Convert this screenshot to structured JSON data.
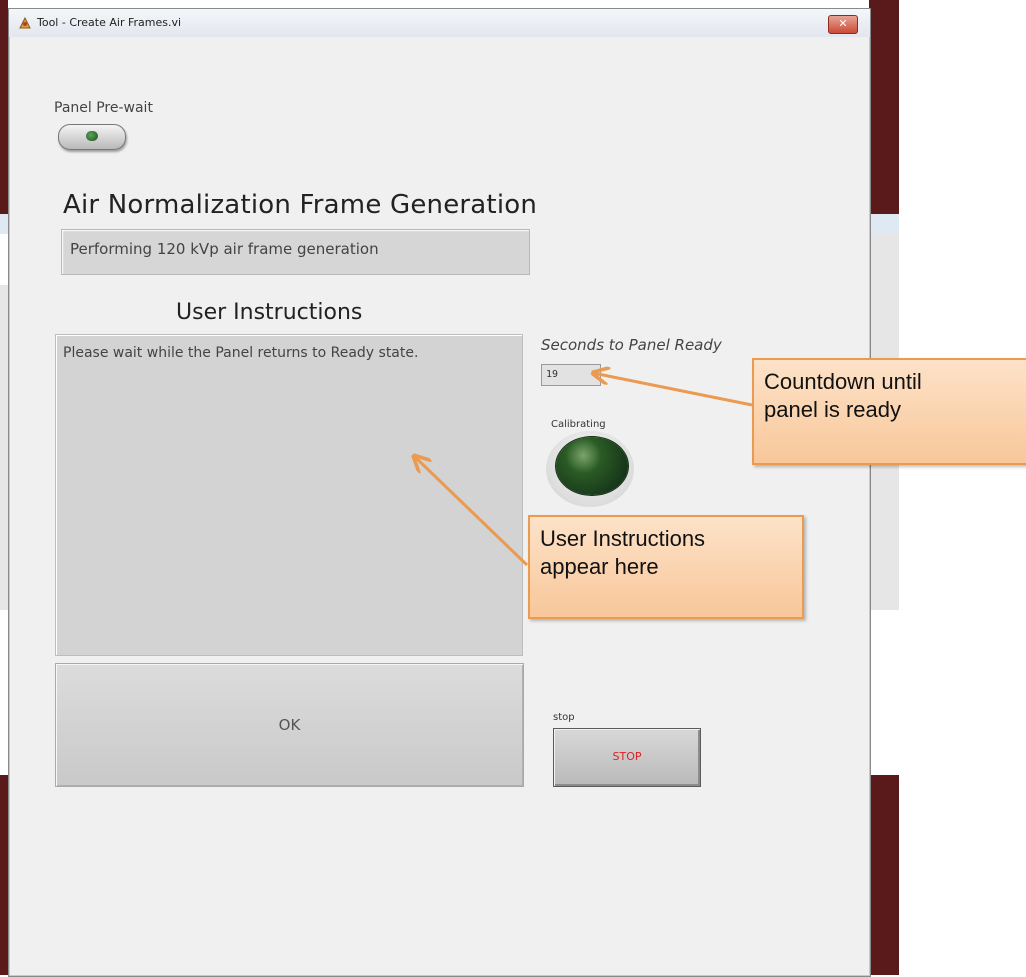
{
  "window": {
    "title": "Tool - Create Air Frames.vi",
    "close_symbol": "✕"
  },
  "panel": {
    "prewait_label": "Panel Pre-wait",
    "heading": "Air Normalization Frame Generation",
    "status": "Performing 120 kVp air frame generation",
    "instructions_heading": "User Instructions",
    "instructions_text": "Please wait while the Panel returns to Ready state.",
    "seconds_label": "Seconds to Panel Ready",
    "seconds_value": "19",
    "calibrating_label": "Calibrating",
    "ok_label": "OK",
    "stop_caption": "stop",
    "stop_label": "STOP"
  },
  "callouts": {
    "countdown": "Countdown until\npanel is ready",
    "instructions": "User Instructions\nappear here"
  },
  "colors": {
    "callout_fill": "#fbd2ac",
    "callout_border": "#ea9a51",
    "led_off": "#1e441e",
    "stop_text": "#e02020"
  },
  "icons": {
    "app": "labview-app-icon",
    "close": "close-icon"
  }
}
